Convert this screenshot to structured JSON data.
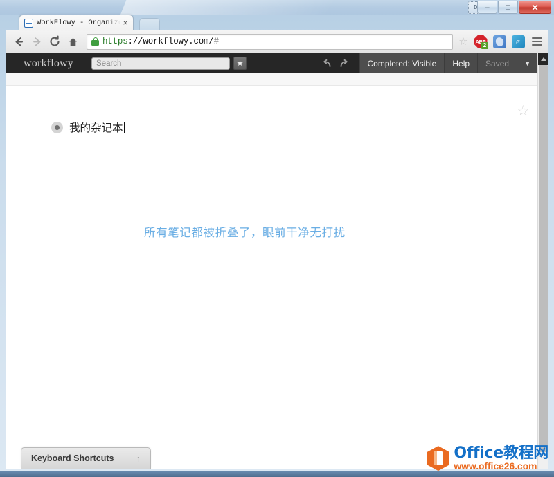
{
  "window": {
    "controls": {
      "minimize": "–",
      "maximize": "□",
      "close": "✕"
    },
    "chrome_badge": "Di"
  },
  "tab": {
    "title": "WorkFlowy - Organize yo",
    "close": "×",
    "favicon_name": "workflowy-favicon"
  },
  "toolbar": {
    "back": "←",
    "forward": "→",
    "reload": "C",
    "home": "⌂",
    "url_scheme": "https",
    "url_rest": "://workflowy.com/",
    "url_hash": "#",
    "bookmark_star": "☆",
    "extensions": [
      {
        "name": "adblock-plus",
        "label": "ABP",
        "badge": "2"
      },
      {
        "name": "blue-circle-extension",
        "label": ""
      },
      {
        "name": "evernote-extension",
        "label": "e"
      }
    ],
    "menu": "≡"
  },
  "app": {
    "logo": "workflowy",
    "search_placeholder": "Search",
    "search_value": "",
    "star_button": "★",
    "undo": "undo",
    "redo": "redo",
    "completed_label": "Completed: Visible",
    "help_label": "Help",
    "saved_label": "Saved",
    "dropdown_caret": "▼"
  },
  "page": {
    "star": "☆",
    "items": [
      {
        "text": "我的杂记本",
        "collapsed": true
      }
    ],
    "annotation": "所有笔记都被折叠了，眼前干净无打扰",
    "annotation_color": "#6aaee4"
  },
  "keyboard_tray": {
    "label": "Keyboard Shortcuts",
    "arrow": "↑"
  },
  "watermark": {
    "title": "Office教程网",
    "url": "www.office26.com",
    "title_color": "#1470c8",
    "url_color": "#ea6a20"
  }
}
